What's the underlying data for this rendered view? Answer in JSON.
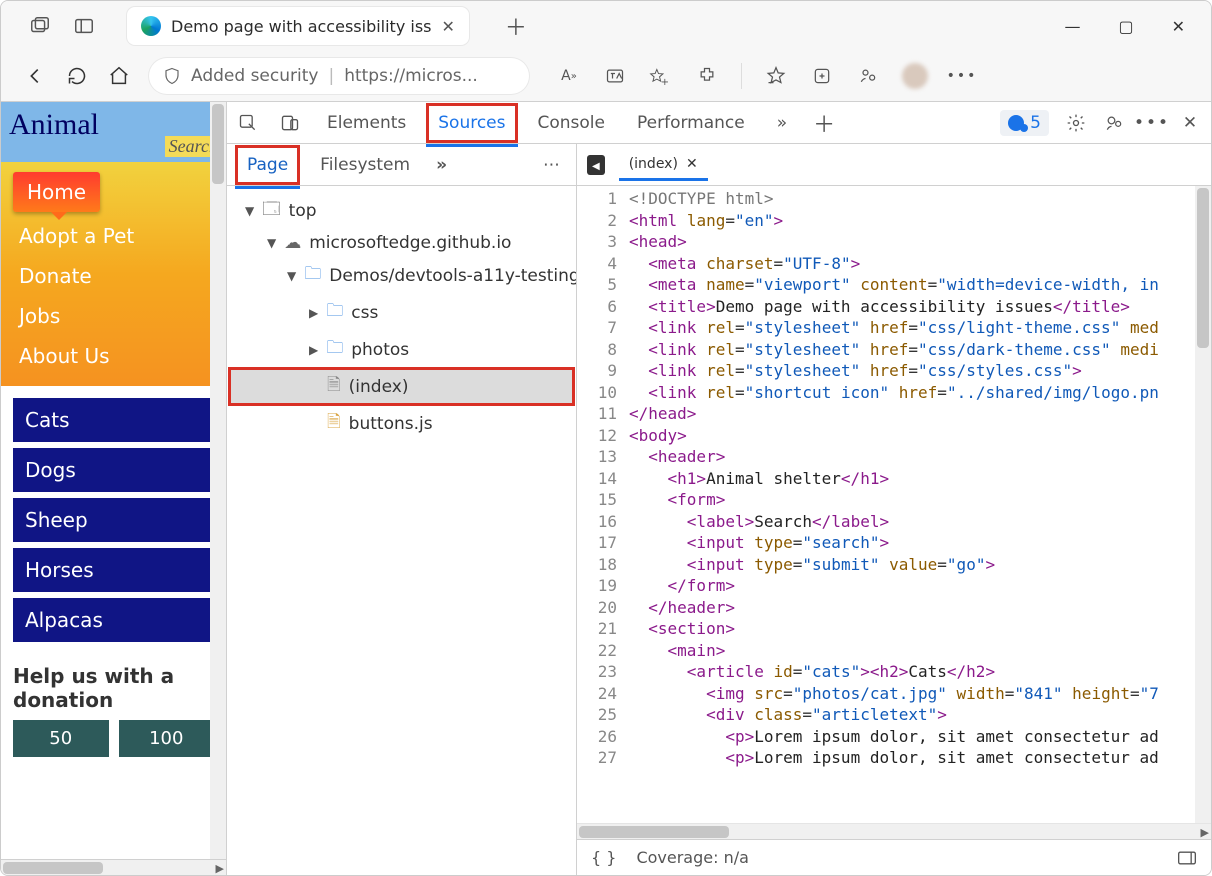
{
  "browser": {
    "tab_title": "Demo page with accessibility iss",
    "security_label": "Added security",
    "url_display": "https://micros..."
  },
  "page": {
    "site_title": "Animal",
    "search_label": "Search",
    "nav_primary": [
      "Home",
      "Adopt a Pet",
      "Donate",
      "Jobs",
      "About Us"
    ],
    "nav_secondary": [
      "Cats",
      "Dogs",
      "Sheep",
      "Horses",
      "Alpacas"
    ],
    "donation_heading": "Help us with a donation",
    "donation_buttons": [
      "50",
      "100"
    ]
  },
  "devtools": {
    "tabs": [
      "Elements",
      "Sources",
      "Console",
      "Performance"
    ],
    "active_tab": "Sources",
    "overflow_glyph": "»",
    "issues_count": "5",
    "navigator": {
      "tabs": [
        "Page",
        "Filesystem"
      ],
      "active": "Page",
      "tree": {
        "top": "top",
        "domain": "microsoftedge.github.io",
        "folder": "Demos/devtools-a11y-testing",
        "children": [
          "css",
          "photos",
          "(index)",
          "buttons.js"
        ],
        "selected": "(index)"
      }
    },
    "editor": {
      "open_file": "(index)",
      "lines": [
        {
          "n": 1,
          "html": "<span class='t-doctype'>&lt;!DOCTYPE&nbsp;html&gt;</span>"
        },
        {
          "n": 2,
          "html": "<span class='t-tag'>&lt;html</span> <span class='t-attr'>lang</span>=<span class='t-str'>\"en\"</span><span class='t-tag'>&gt;</span>"
        },
        {
          "n": 3,
          "html": "<span class='t-tag'>&lt;head&gt;</span>"
        },
        {
          "n": 4,
          "html": "&nbsp;&nbsp;<span class='t-tag'>&lt;meta</span> <span class='t-attr'>charset</span>=<span class='t-str'>\"UTF-8\"</span><span class='t-tag'>&gt;</span>"
        },
        {
          "n": 5,
          "html": "&nbsp;&nbsp;<span class='t-tag'>&lt;meta</span> <span class='t-attr'>name</span>=<span class='t-str'>\"viewport\"</span> <span class='t-attr'>content</span>=<span class='t-str'>\"width=device-width, in</span>"
        },
        {
          "n": 6,
          "html": "&nbsp;&nbsp;<span class='t-tag'>&lt;title&gt;</span><span class='t-txt'>Demo page with accessibility issues</span><span class='t-tag'>&lt;/title&gt;</span>"
        },
        {
          "n": 7,
          "html": "&nbsp;&nbsp;<span class='t-tag'>&lt;link</span> <span class='t-attr'>rel</span>=<span class='t-str'>\"stylesheet\"</span> <span class='t-attr'>href</span>=<span class='t-str'>\"css/light-theme.css\"</span> <span class='t-attr'>med</span>"
        },
        {
          "n": 8,
          "html": "&nbsp;&nbsp;<span class='t-tag'>&lt;link</span> <span class='t-attr'>rel</span>=<span class='t-str'>\"stylesheet\"</span> <span class='t-attr'>href</span>=<span class='t-str'>\"css/dark-theme.css\"</span> <span class='t-attr'>medi</span>"
        },
        {
          "n": 9,
          "html": "&nbsp;&nbsp;<span class='t-tag'>&lt;link</span> <span class='t-attr'>rel</span>=<span class='t-str'>\"stylesheet\"</span> <span class='t-attr'>href</span>=<span class='t-str'>\"css/styles.css\"</span><span class='t-tag'>&gt;</span>"
        },
        {
          "n": 10,
          "html": "&nbsp;&nbsp;<span class='t-tag'>&lt;link</span> <span class='t-attr'>rel</span>=<span class='t-str'>\"shortcut icon\"</span> <span class='t-attr'>href</span>=<span class='t-str'>\"../shared/img/logo.pn</span>"
        },
        {
          "n": 11,
          "html": "<span class='t-tag'>&lt;/head&gt;</span>"
        },
        {
          "n": 12,
          "html": "<span class='t-tag'>&lt;body&gt;</span>"
        },
        {
          "n": 13,
          "html": "&nbsp;&nbsp;<span class='t-tag'>&lt;header&gt;</span>"
        },
        {
          "n": 14,
          "html": "&nbsp;&nbsp;&nbsp;&nbsp;<span class='t-tag'>&lt;h1&gt;</span><span class='t-txt'>Animal shelter</span><span class='t-tag'>&lt;/h1&gt;</span>"
        },
        {
          "n": 15,
          "html": "&nbsp;&nbsp;&nbsp;&nbsp;<span class='t-tag'>&lt;form&gt;</span>"
        },
        {
          "n": 16,
          "html": "&nbsp;&nbsp;&nbsp;&nbsp;&nbsp;&nbsp;<span class='t-tag'>&lt;label&gt;</span><span class='t-txt'>Search</span><span class='t-tag'>&lt;/label&gt;</span>"
        },
        {
          "n": 17,
          "html": "&nbsp;&nbsp;&nbsp;&nbsp;&nbsp;&nbsp;<span class='t-tag'>&lt;input</span> <span class='t-attr'>type</span>=<span class='t-str'>\"search\"</span><span class='t-tag'>&gt;</span>"
        },
        {
          "n": 18,
          "html": "&nbsp;&nbsp;&nbsp;&nbsp;&nbsp;&nbsp;<span class='t-tag'>&lt;input</span> <span class='t-attr'>type</span>=<span class='t-str'>\"submit\"</span> <span class='t-attr'>value</span>=<span class='t-str'>\"go\"</span><span class='t-tag'>&gt;</span>"
        },
        {
          "n": 19,
          "html": "&nbsp;&nbsp;&nbsp;&nbsp;<span class='t-tag'>&lt;/form&gt;</span>"
        },
        {
          "n": 20,
          "html": "&nbsp;&nbsp;<span class='t-tag'>&lt;/header&gt;</span>"
        },
        {
          "n": 21,
          "html": "&nbsp;&nbsp;<span class='t-tag'>&lt;section&gt;</span>"
        },
        {
          "n": 22,
          "html": "&nbsp;&nbsp;&nbsp;&nbsp;<span class='t-tag'>&lt;main&gt;</span>"
        },
        {
          "n": 23,
          "html": "&nbsp;&nbsp;&nbsp;&nbsp;&nbsp;&nbsp;<span class='t-tag'>&lt;article</span> <span class='t-attr'>id</span>=<span class='t-str'>\"cats\"</span><span class='t-tag'>&gt;&lt;h2&gt;</span><span class='t-txt'>Cats</span><span class='t-tag'>&lt;/h2&gt;</span>"
        },
        {
          "n": 24,
          "html": "&nbsp;&nbsp;&nbsp;&nbsp;&nbsp;&nbsp;&nbsp;&nbsp;<span class='t-tag'>&lt;img</span> <span class='t-attr'>src</span>=<span class='t-str'>\"photos/cat.jpg\"</span> <span class='t-attr'>width</span>=<span class='t-str'>\"841\"</span> <span class='t-attr'>height</span>=<span class='t-str'>\"7</span>"
        },
        {
          "n": 25,
          "html": "&nbsp;&nbsp;&nbsp;&nbsp;&nbsp;&nbsp;&nbsp;&nbsp;<span class='t-tag'>&lt;div</span> <span class='t-attr'>class</span>=<span class='t-str'>\"articletext\"</span><span class='t-tag'>&gt;</span>"
        },
        {
          "n": 26,
          "html": "&nbsp;&nbsp;&nbsp;&nbsp;&nbsp;&nbsp;&nbsp;&nbsp;&nbsp;&nbsp;<span class='t-tag'>&lt;p&gt;</span><span class='t-txt'>Lorem ipsum dolor, sit amet consectetur ad</span>"
        },
        {
          "n": 27,
          "html": "&nbsp;&nbsp;&nbsp;&nbsp;&nbsp;&nbsp;&nbsp;&nbsp;&nbsp;&nbsp;<span class='t-tag'>&lt;p&gt;</span><span class='t-txt'>Lorem ipsum dolor, sit amet consectetur ad</span>"
        }
      ]
    },
    "status": {
      "coverage": "Coverage: n/a"
    }
  }
}
